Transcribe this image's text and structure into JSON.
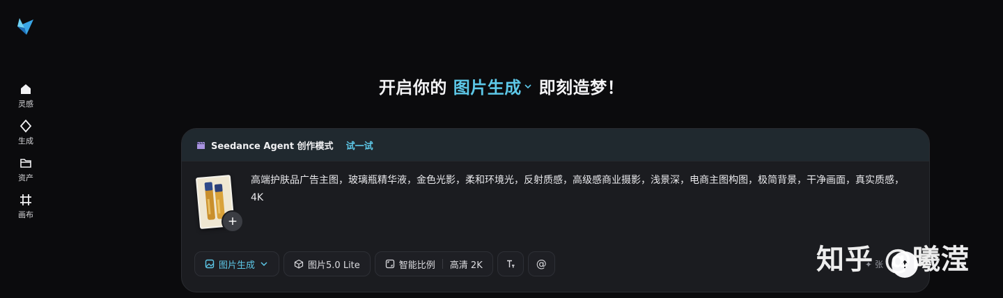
{
  "colors": {
    "accent": "#5dc8e8",
    "background": "#0b0b0d",
    "card": "#1b1c20"
  },
  "sidebar": {
    "items": [
      {
        "icon": "home-icon",
        "label": "灵感"
      },
      {
        "icon": "sparkle-icon",
        "label": "生成"
      },
      {
        "icon": "folder-icon",
        "label": "资产"
      },
      {
        "icon": "canvas-icon",
        "label": "画布"
      }
    ]
  },
  "hero": {
    "prefix": "开启你的",
    "mode": "图片生成",
    "suffix": "即刻造梦！"
  },
  "agent": {
    "title": "Seedance Agent 创作模式",
    "try_label": "试一试"
  },
  "prompt": {
    "text": "高端护肤品广告主图，玻璃瓶精华液，金色光影，柔和环境光，反射质感，高级感商业摄影，浅景深，电商主图构图，极简背景，干净画面，真实质感，4K"
  },
  "toolbar": {
    "mode_label": "图片生成",
    "model_label": "图片5.0 Lite",
    "ratio_label": "智能比例",
    "quality_label": "高清 2K",
    "mention_label": "@"
  },
  "output": {
    "count_suffix": "张"
  },
  "watermark": {
    "text": "知乎 @曦滢"
  }
}
